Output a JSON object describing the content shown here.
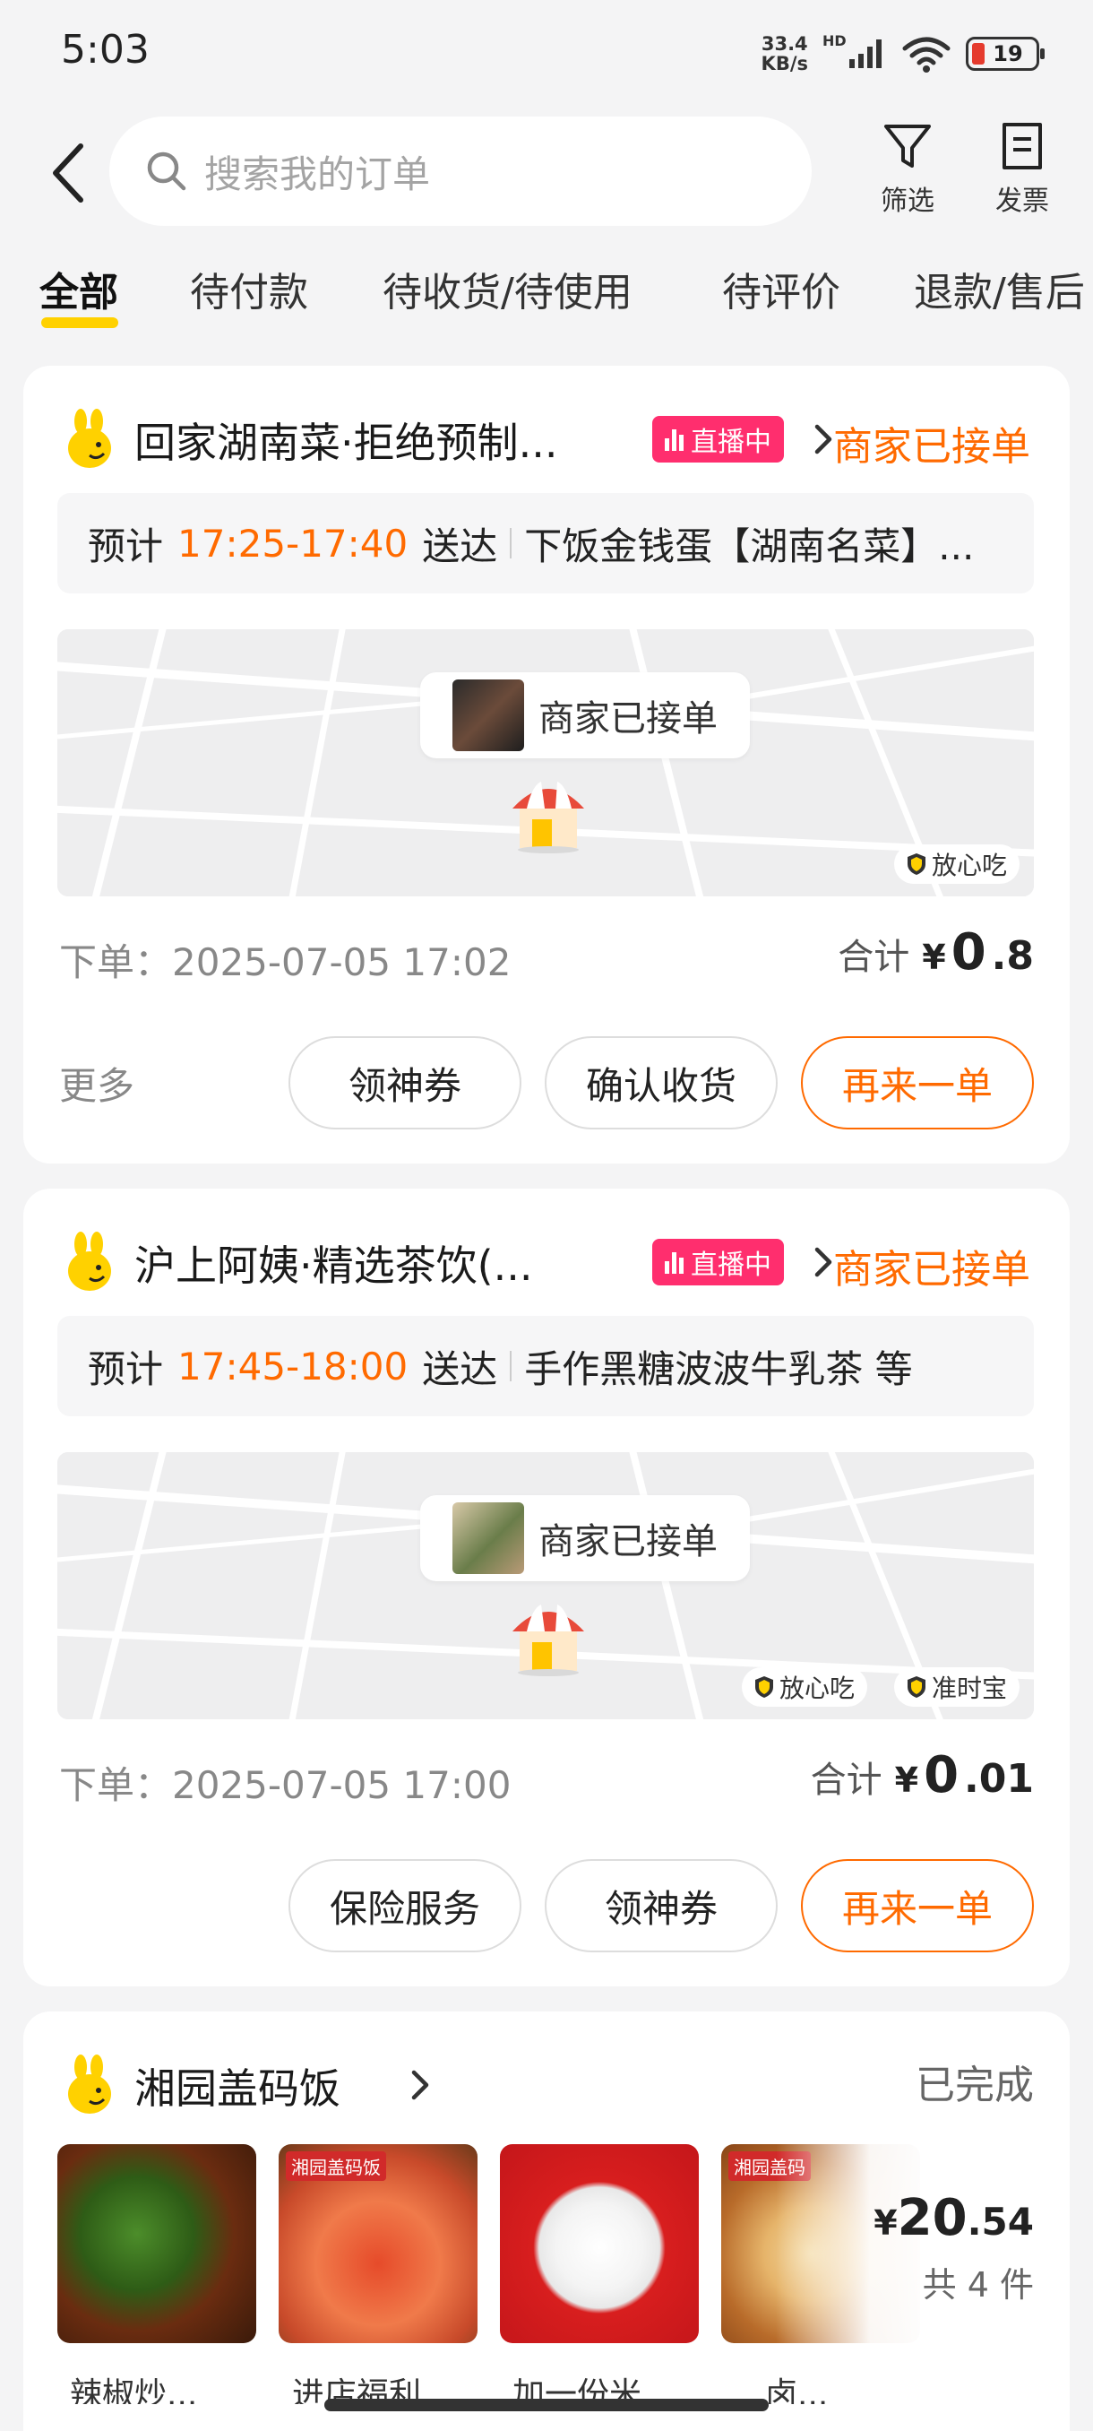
{
  "status_bar": {
    "time": "5:03",
    "net_speed_value": "33.4",
    "net_speed_unit": "KB/s",
    "network_type": "HD",
    "battery": "19",
    "battery_color": "#e53b2e"
  },
  "header": {
    "search_placeholder": "搜索我的订单",
    "filter_label": "筛选",
    "invoice_label": "发票"
  },
  "tabs": [
    "全部",
    "待付款",
    "待收货/待使用",
    "待评价",
    "退款/售后"
  ],
  "accent_color": "#ff6a00",
  "live_badge_color": "#ff2e6e",
  "orders": [
    {
      "shop": "回家湖南菜·拒绝预制...",
      "live": "直播中",
      "status": "商家已接单",
      "eta_prefix": "预计",
      "eta_time": "17:25-17:40",
      "eta_suffix": "送达",
      "items": "下饭金钱蛋【湖南名菜】...",
      "map_status": "商家已接单",
      "tags": [
        "放心吃"
      ],
      "order_time": "下单：2025-07-05 17:02",
      "total_label": "合计",
      "currency": "¥",
      "total_int": "0",
      "total_dec": ".8",
      "more": "更多",
      "actions": [
        "领神券",
        "确认收货",
        "再来一单"
      ]
    },
    {
      "shop": "沪上阿姨·精选茶饮(...",
      "live": "直播中",
      "status": "商家已接单",
      "eta_prefix": "预计",
      "eta_time": "17:45-18:00",
      "eta_suffix": "送达",
      "items": "手作黑糖波波牛乳茶 等",
      "map_status": "商家已接单",
      "tags": [
        "放心吃",
        "准时宝"
      ],
      "order_time": "下单：2025-07-05 17:00",
      "total_label": "合计",
      "currency": "¥",
      "total_int": "0",
      "total_dec": ".01",
      "actions": [
        "保险服务",
        "领神券",
        "再来一单"
      ]
    },
    {
      "shop": "湘园盖码饭",
      "status": "已完成",
      "product_tags": [
        "湘园盖码饭",
        "湘园盖码"
      ],
      "currency": "¥",
      "total_int": "20",
      "total_dec": ".54",
      "count": "共 4 件",
      "product_names": [
        "辣椒炒...",
        "进店福利...",
        "加一份米...",
        "卤..."
      ]
    }
  ]
}
